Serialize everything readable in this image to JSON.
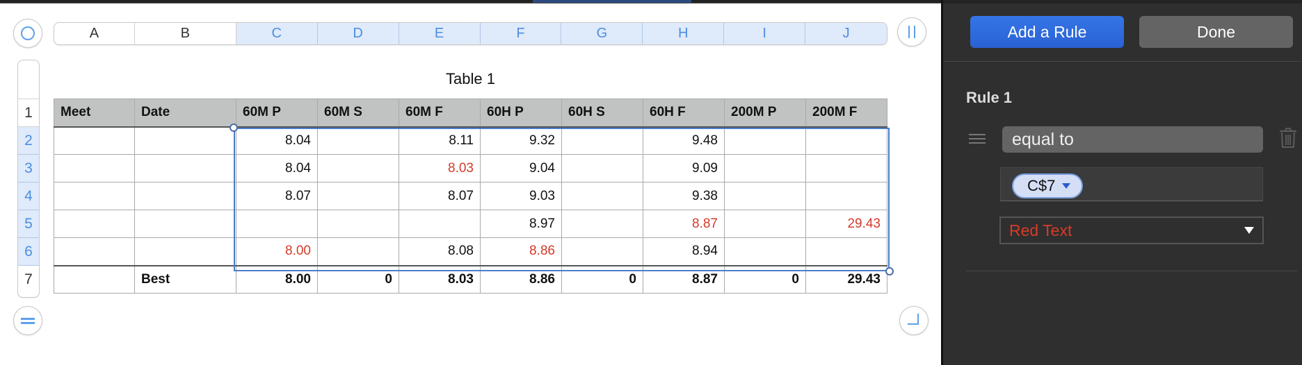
{
  "table": {
    "title": "Table 1",
    "column_letters": [
      "A",
      "B",
      "C",
      "D",
      "E",
      "F",
      "G",
      "H",
      "I",
      "J"
    ],
    "selected_columns": [
      "C",
      "D",
      "E",
      "F",
      "G",
      "H",
      "I",
      "J"
    ],
    "row_numbers": [
      "1",
      "2",
      "3",
      "4",
      "5",
      "6",
      "7"
    ],
    "selected_rows": [
      "2",
      "3",
      "4",
      "5",
      "6"
    ],
    "headers": [
      "Meet",
      "Date",
      "60M P",
      "60M S",
      "60M F",
      "60H P",
      "60H S",
      "60H F",
      "200M P",
      "200M F"
    ],
    "rows": [
      [
        "",
        "",
        "8.04",
        "",
        "8.11",
        "9.32",
        "",
        "9.48",
        "",
        ""
      ],
      [
        "",
        "",
        "8.04",
        "",
        "8.03",
        "9.04",
        "",
        "9.09",
        "",
        ""
      ],
      [
        "",
        "",
        "8.07",
        "",
        "8.07",
        "9.03",
        "",
        "9.38",
        "",
        ""
      ],
      [
        "",
        "",
        "",
        "",
        "",
        "8.97",
        "",
        "8.87",
        "",
        "29.43"
      ],
      [
        "",
        "",
        "8.00",
        "",
        "8.08",
        "8.86",
        "",
        "8.94",
        "",
        ""
      ]
    ],
    "red_cells": [
      [
        1,
        4
      ],
      [
        3,
        7
      ],
      [
        3,
        9
      ],
      [
        4,
        2
      ],
      [
        4,
        5
      ]
    ],
    "footer": [
      "",
      "Best",
      "8.00",
      "0",
      "8.03",
      "8.86",
      "0",
      "8.87",
      "0",
      "29.43"
    ],
    "selection_range": "C2:J6"
  },
  "panel": {
    "add_rule_label": "Add a Rule",
    "done_label": "Done",
    "rule_title": "Rule 1",
    "condition": "equal to",
    "value_reference": "C$7",
    "style_option": "Red Text"
  },
  "colors": {
    "accent_blue": "#3575e6",
    "highlight_red": "#d23b2a",
    "selection_blue": "#4a7cc9"
  }
}
